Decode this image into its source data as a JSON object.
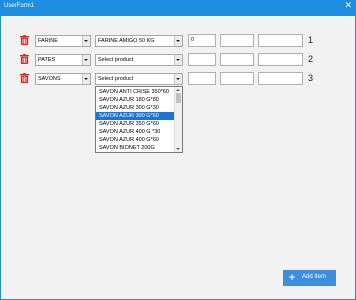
{
  "window": {
    "title": "UserForm1",
    "close_glyph": "✕"
  },
  "rows": [
    {
      "category": "FARINE",
      "product": "FARINE AMIGO 50 KG",
      "qty": "0",
      "field2": "",
      "field3": "",
      "number": "1"
    },
    {
      "category": "PATES",
      "product": "Select product",
      "qty": "",
      "field2": "",
      "field3": "",
      "number": "2"
    },
    {
      "category": "SAVONS",
      "product": "Select product",
      "qty": "",
      "field2": "",
      "field3": "",
      "number": "3"
    }
  ],
  "dropdown": {
    "options": [
      "SAVON ANTI CRISE 350*60",
      "SAVON AZUR 180 G*80",
      "SAVON AZUR 300 G*30",
      "SAVON AZUR 300 G*60",
      "SAVON AZUR 350 G*60",
      "SAVON AZUR 400 G *30",
      "SAVON AZUR 400 G*60",
      "SAVON BIONET 200G"
    ],
    "selected_index": 3
  },
  "add_button": {
    "label": "Add Item",
    "icon": "plus-icon"
  },
  "colors": {
    "accent": "#1e8fe0",
    "delete": "#d9261c",
    "button": "#3d8ee0",
    "selected": "#1a73d8"
  }
}
